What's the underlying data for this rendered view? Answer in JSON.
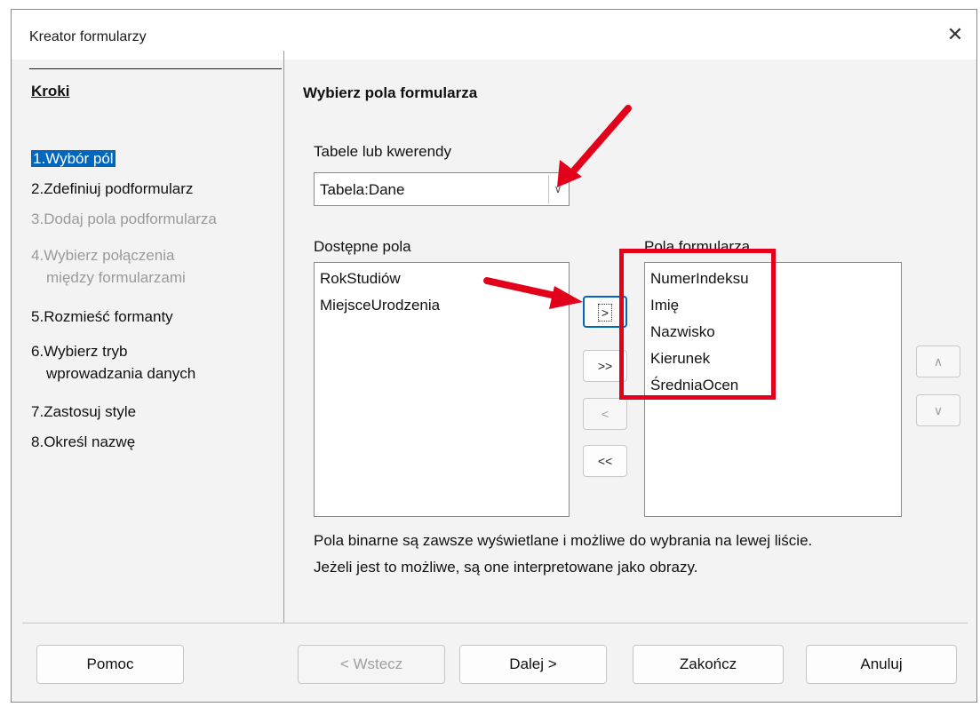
{
  "window": {
    "title": "Kreator formularzy",
    "close_glyph": "✕"
  },
  "steps": {
    "title": "Kroki",
    "items": [
      {
        "num": "1.",
        "label": "Wybór pól"
      },
      {
        "num": "2.",
        "label": "Zdefiniuj podformularz"
      },
      {
        "num": "3.",
        "label": "Dodaj pola podformularza"
      },
      {
        "num": "4.",
        "label": "Wybierz połączenia",
        "label2": "między formularzami"
      },
      {
        "num": "5.",
        "label": "Rozmieść formanty"
      },
      {
        "num": "6.",
        "label": "Wybierz tryb",
        "label2": "wprowadzania danych"
      },
      {
        "num": "7.",
        "label": "Zastosuj style"
      },
      {
        "num": "8.",
        "label": "Określ nazwę"
      }
    ]
  },
  "main": {
    "section_title": "Wybierz pola formularza",
    "tables_label": "Tabele lub kwerendy",
    "table_value": "Tabela:Dane",
    "available_label": "Dostępne pola",
    "form_fields_label": "Pola formularza",
    "available_fields": [
      "RokStudiów",
      "MiejsceUrodzenia"
    ],
    "form_fields": [
      "NumerIndeksu",
      "Imię",
      "Nazwisko",
      "Kierunek",
      "ŚredniaOcen"
    ],
    "move": {
      "add_one": ">",
      "add_all": ">>",
      "remove_one": "<",
      "remove_all": "<<"
    },
    "order": {
      "up": "∧",
      "down": "∨"
    },
    "description_line1": "Pola binarne są zawsze wyświetlane i możliwe do wybrania na lewej liście.",
    "description_line2": "Jeżeli jest to możliwe, są one interpretowane jako obrazy."
  },
  "footer": {
    "help": "Pomoc",
    "back": "< Wstecz",
    "next": "Dalej >",
    "finish": "Zakończ",
    "cancel": "Anuluj"
  },
  "colors": {
    "highlight": "#0067c0",
    "annotation": "#e2001a"
  }
}
